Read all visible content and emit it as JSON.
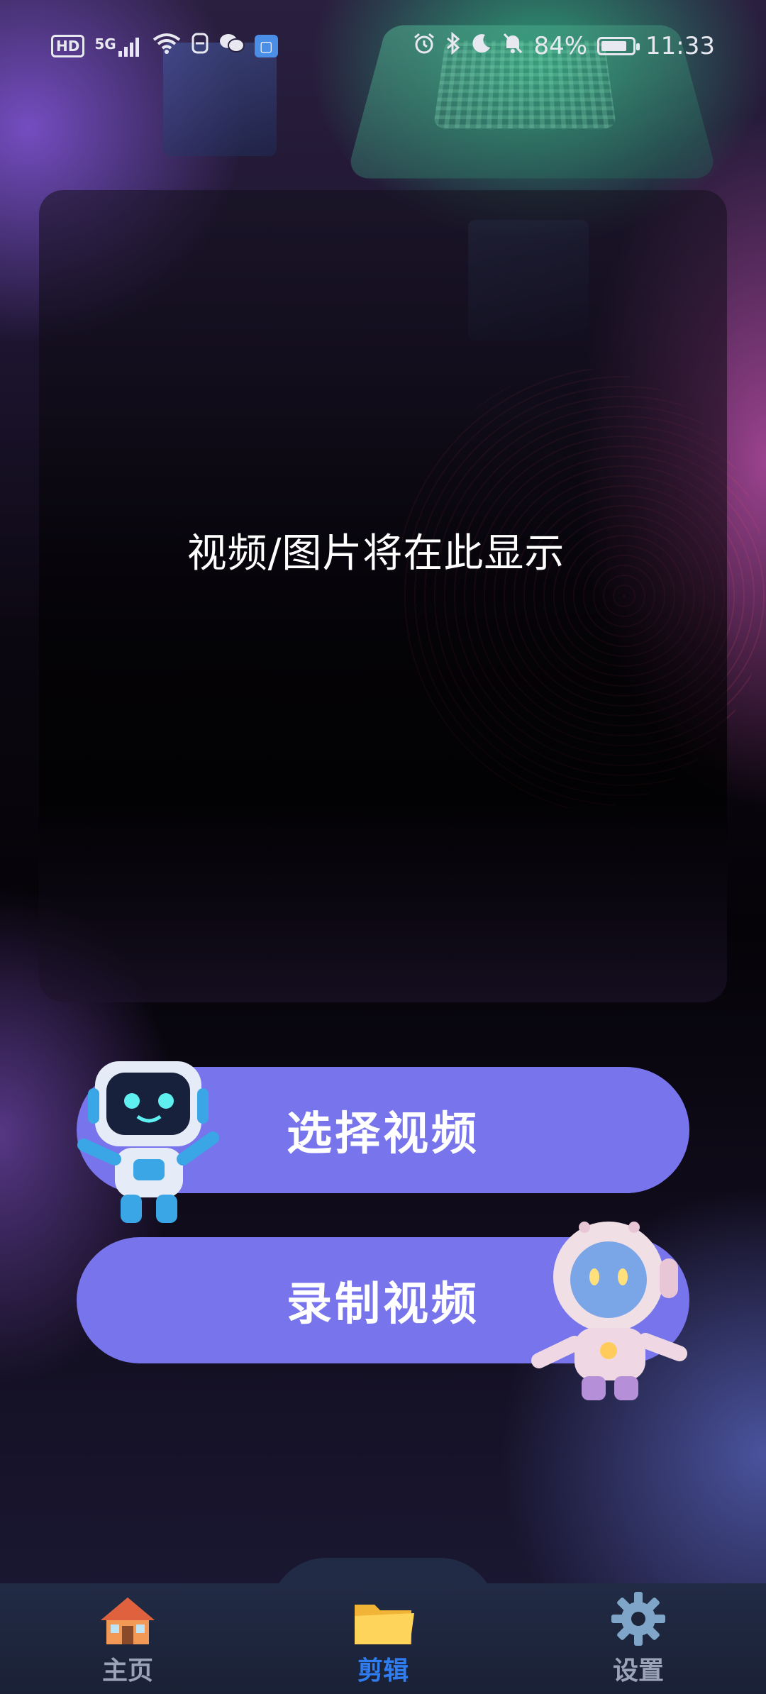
{
  "status_bar": {
    "left_icons": [
      "hd-icon",
      "5g-signal-icon",
      "wifi-icon",
      "data-saver-icon",
      "wechat-icon",
      "app-notification-icon"
    ],
    "hd_label": "HD",
    "network_label": "5G",
    "right_icons": [
      "alarm-icon",
      "bluetooth-icon",
      "moon-icon",
      "mute-bell-icon"
    ],
    "battery_text": "84%",
    "battery_level": 0.84,
    "time": "11:33"
  },
  "preview": {
    "placeholder_text": "视频/图片将在此显示"
  },
  "actions": {
    "select_video_label": "选择视频",
    "record_video_label": "录制视频"
  },
  "colors": {
    "button": "#7774ec",
    "active_tab": "#2f7df0",
    "inactive_tab": "#9aa3b8",
    "tab_bar": "#222b45"
  },
  "tab_bar": {
    "items": [
      {
        "label": "主页",
        "icon": "house-icon",
        "active": false
      },
      {
        "label": "剪辑",
        "icon": "folder-icon",
        "active": true
      },
      {
        "label": "设置",
        "icon": "gear-icon",
        "active": false
      }
    ]
  }
}
